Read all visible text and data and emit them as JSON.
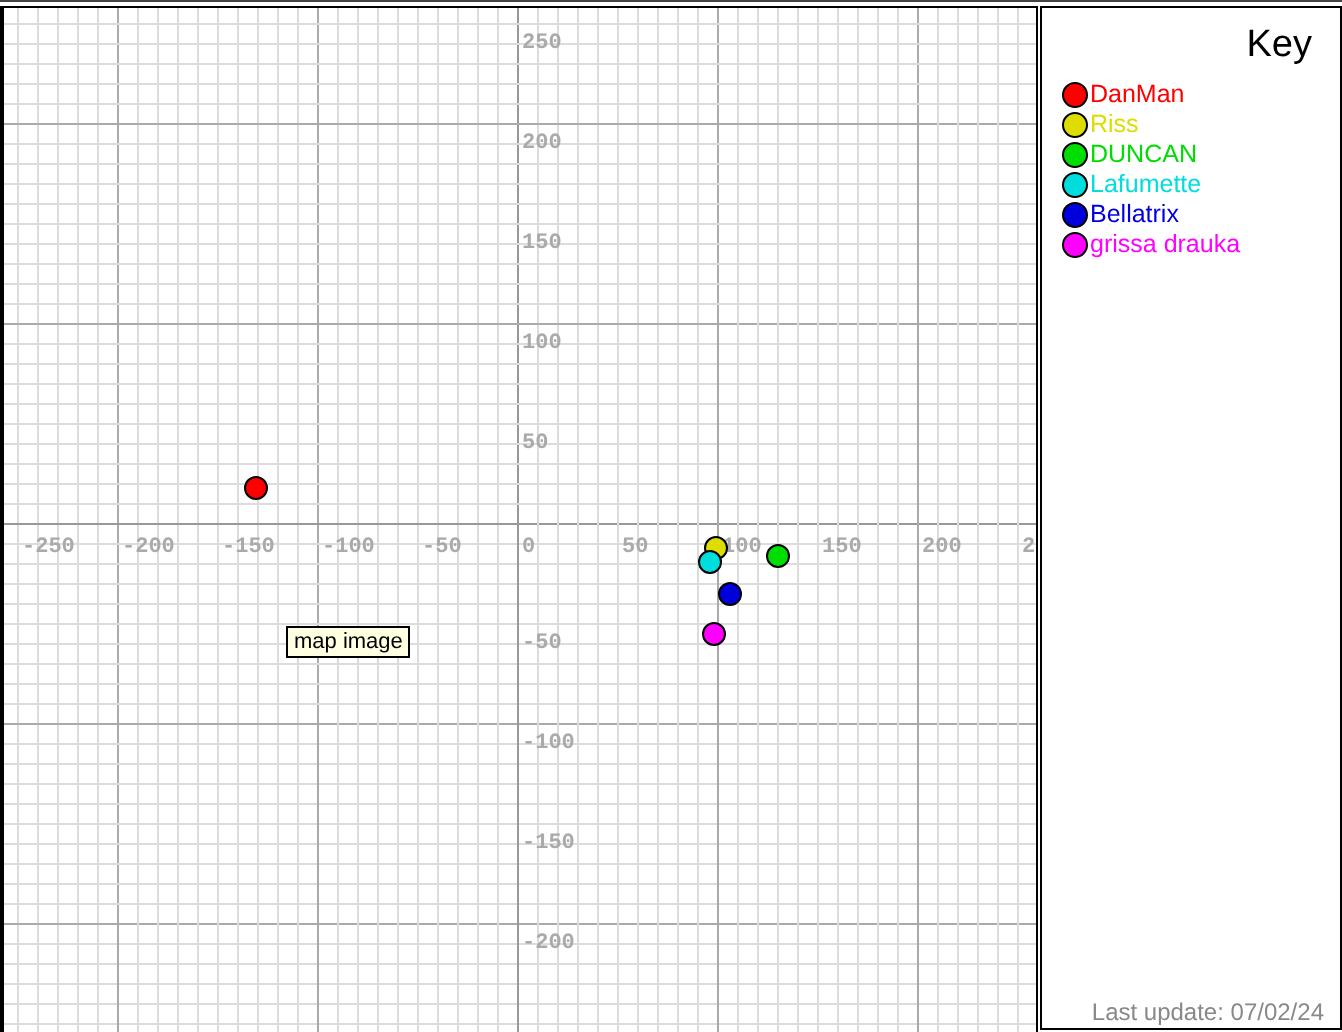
{
  "map": {
    "tooltip": "map image",
    "x_labels": [
      "-250",
      "-200",
      "-150",
      "-100",
      "-50",
      "0",
      "50",
      "100",
      "150",
      "200",
      "2"
    ],
    "y_labels": [
      "250",
      "200",
      "150",
      "100",
      "50",
      "-50",
      "-100",
      "-150",
      "-200"
    ],
    "markers": [
      {
        "color": "#ff0000"
      },
      {
        "color": "#dddd00"
      },
      {
        "color": "#00dd00"
      },
      {
        "color": "#00dddd"
      },
      {
        "color": "#0000dd"
      },
      {
        "color": "#ff00ff"
      }
    ]
  },
  "key": {
    "title": "Key",
    "items": [
      {
        "name": "DanMan",
        "color": "#ff0000"
      },
      {
        "name": "Riss",
        "color": "#dddd00"
      },
      {
        "name": "DUNCAN",
        "color": "#00dd00"
      },
      {
        "name": "Lafumette",
        "color": "#00dddd"
      },
      {
        "name": "Bellatrix",
        "color": "#0000dd"
      },
      {
        "name": "grissa drauka",
        "color": "#ff00ff"
      }
    ]
  },
  "last_update": "Last update: 07/02/24"
}
